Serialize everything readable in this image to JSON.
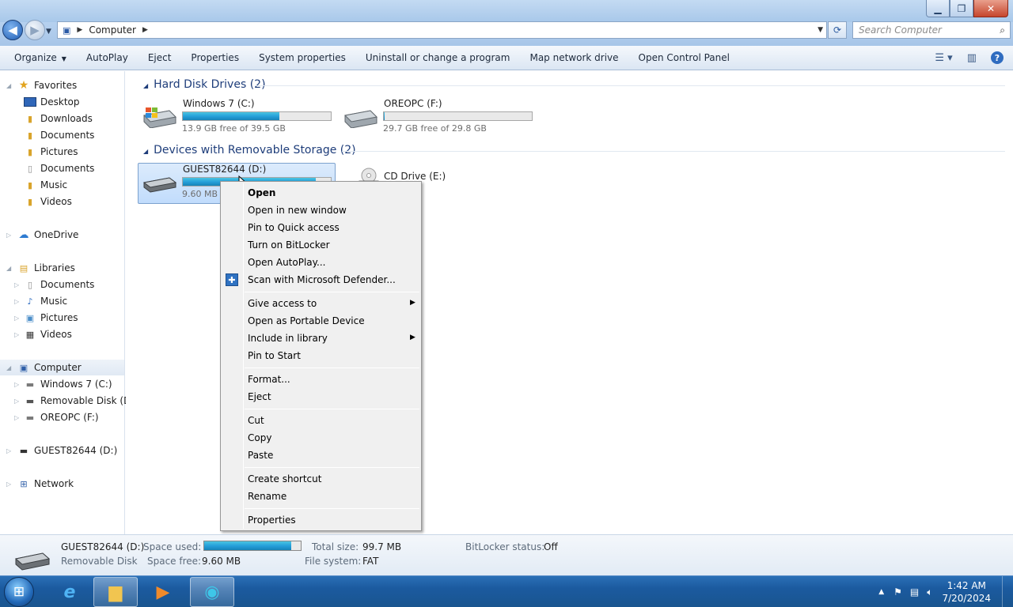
{
  "window": {
    "controls": {
      "minimize": "▁",
      "restore": "❐",
      "close": "✕"
    }
  },
  "address": {
    "breadcrumb": "Computer",
    "search_placeholder": "Search Computer"
  },
  "toolbar": {
    "organize": "Organize",
    "autoplay": "AutoPlay",
    "eject": "Eject",
    "properties": "Properties",
    "system_properties": "System properties",
    "uninstall": "Uninstall or change a program",
    "map_network": "Map network drive",
    "open_control_panel": "Open Control Panel"
  },
  "nav": {
    "favorites": "Favorites",
    "desktop": "Desktop",
    "downloads": "Downloads",
    "documents1": "Documents",
    "pictures1": "Pictures",
    "documents2": "Documents",
    "music1": "Music",
    "videos1": "Videos",
    "onedrive": "OneDrive",
    "libraries": "Libraries",
    "lib_documents": "Documents",
    "lib_music": "Music",
    "lib_pictures": "Pictures",
    "lib_videos": "Videos",
    "computer": "Computer",
    "win7": "Windows 7 (C:)",
    "removable": "Removable Disk (D:)",
    "oreopc": "OREOPC (F:)",
    "guest": "GUEST82644 (D:)",
    "network": "Network"
  },
  "groups": {
    "hdd": "Hard Disk Drives (2)",
    "removable": "Devices with Removable Storage (2)"
  },
  "drives": {
    "c": {
      "name": "Windows 7 (C:)",
      "free": "13.9 GB free of 39.5 GB",
      "used_fraction": 0.65
    },
    "f": {
      "name": "OREOPC (F:)",
      "free": "29.7 GB free of 29.8 GB",
      "used_fraction": 0.003
    },
    "d": {
      "name": "GUEST82644 (D:)",
      "free": "9.60 MB",
      "used_fraction": 0.9
    },
    "e": {
      "name": "CD Drive (E:)"
    }
  },
  "context_menu": {
    "open": "Open",
    "open_new_window": "Open in new window",
    "pin_quick": "Pin to Quick access",
    "bitlocker": "Turn on BitLocker",
    "autoplay": "Open AutoPlay...",
    "defender": "Scan with Microsoft Defender...",
    "give_access": "Give access to",
    "portable": "Open as Portable Device",
    "include_library": "Include in library",
    "pin_start": "Pin to Start",
    "format": "Format...",
    "eject": "Eject",
    "cut": "Cut",
    "copy": "Copy",
    "paste": "Paste",
    "create_shortcut": "Create shortcut",
    "rename": "Rename",
    "properties": "Properties"
  },
  "details": {
    "name": "GUEST82644 (D:)",
    "type": "Removable Disk",
    "space_used_label": "Space used:",
    "space_free_label": "Space free:",
    "space_free": "9.60 MB",
    "used_fraction": 0.9,
    "total_label": "Total size:",
    "total": "99.7 MB",
    "fs_label": "File system:",
    "fs": "FAT",
    "bitlocker_label": "BitLocker status:",
    "bitlocker": "Off"
  },
  "taskbar": {
    "time": "1:42 AM",
    "date": "7/20/2024"
  },
  "colors": {
    "accent": "#26a0da",
    "taskbar": "#1b5a9f",
    "group_title": "#1e3d7a"
  }
}
